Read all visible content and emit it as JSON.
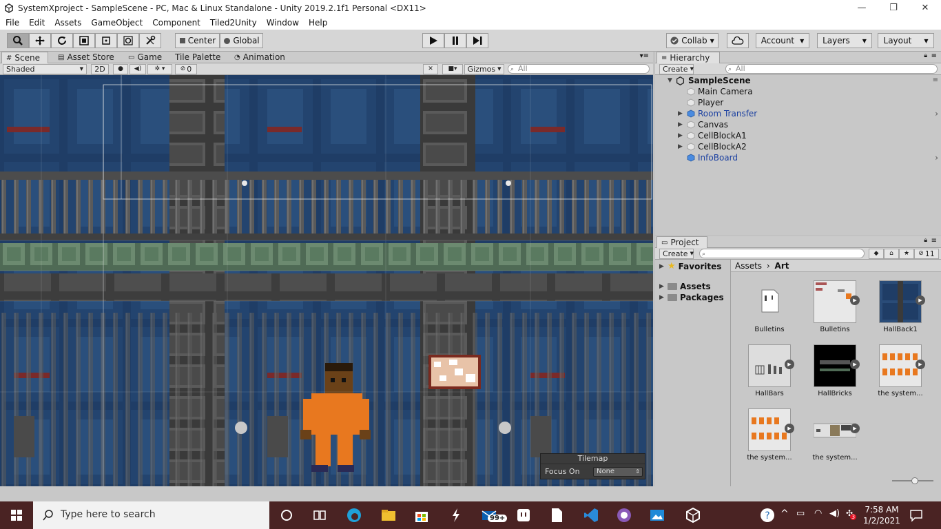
{
  "window": {
    "title": "SystemXproject - SampleScene - PC, Mac & Linux Standalone - Unity 2019.2.1f1 Personal <DX11>",
    "controls": [
      "—",
      "❐",
      "✕"
    ]
  },
  "menu": [
    "File",
    "Edit",
    "Assets",
    "GameObject",
    "Component",
    "Tiled2Unity",
    "Window",
    "Help"
  ],
  "toolbar": {
    "pivot_label": "Center",
    "space_label": "Global",
    "collab_label": "Collab",
    "account_label": "Account",
    "layers_label": "Layers",
    "layout_label": "Layout"
  },
  "scene_tabs": [
    "Scene",
    "Asset Store",
    "Game",
    "Tile Palette",
    "Animation"
  ],
  "scene_bar": {
    "shading": "Shaded",
    "mode_2d": "2D",
    "hidden_count": "0",
    "gizmos": "Gizmos",
    "search_placeholder": "All"
  },
  "hierarchy": {
    "tab": "Hierarchy",
    "create": "Create",
    "search_placeholder": "All",
    "scene": "SampleScene",
    "items": [
      {
        "label": "Main Camera",
        "prefab": false,
        "expandable": false
      },
      {
        "label": "Player",
        "prefab": false,
        "expandable": false
      },
      {
        "label": "Room Transfer",
        "prefab": true,
        "expandable": true
      },
      {
        "label": "Canvas",
        "prefab": false,
        "expandable": true
      },
      {
        "label": "CellBlockA1",
        "prefab": false,
        "expandable": true
      },
      {
        "label": "CellBlockA2",
        "prefab": false,
        "expandable": true
      },
      {
        "label": "InfoBoard",
        "prefab": true,
        "expandable": false
      }
    ]
  },
  "project": {
    "tab": "Project",
    "create": "Create",
    "hidden_count": "11",
    "tree": [
      "Favorites",
      "Assets",
      "Packages"
    ],
    "breadcrumb": [
      "Assets",
      "Art"
    ],
    "assets": [
      {
        "name": "Bulletins",
        "kind": "file"
      },
      {
        "name": "Bulletins",
        "kind": "sprite-board"
      },
      {
        "name": "HallBack1",
        "kind": "sprite-hall"
      },
      {
        "name": "HallBars",
        "kind": "sprite-bars"
      },
      {
        "name": "HallBricks",
        "kind": "sprite-bricks"
      },
      {
        "name": "the system...",
        "kind": "sprite-people"
      },
      {
        "name": "the system...",
        "kind": "sprite-people"
      },
      {
        "name": "the system...",
        "kind": "sprite-strip"
      }
    ]
  },
  "tilemap_overlay": {
    "title": "Tilemap",
    "focus_label": "Focus On",
    "focus_value": "None"
  },
  "taskbar": {
    "search_placeholder": "Type here to search",
    "mail_badge": "99+",
    "time": "7:58 AM",
    "date": "1/2/2021",
    "notification_count": "3"
  },
  "colors": {
    "scene_bg": "#1e3b63",
    "wall_dark": "#3c3c3c",
    "prisoner": "#e8781f",
    "taskbar": "#4a2323",
    "prefab_text": "#1a3fa0"
  }
}
